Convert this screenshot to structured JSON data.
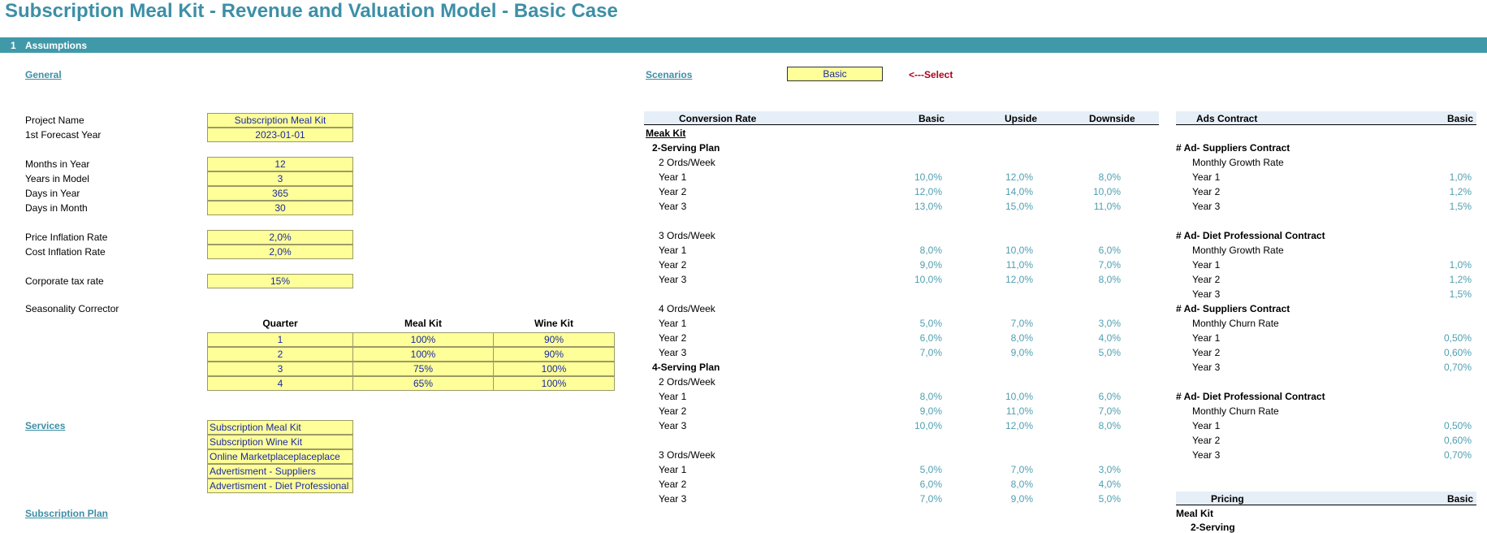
{
  "title": "Subscription Meal Kit - Revenue and Valuation Model - Basic Case",
  "section": {
    "number": "1",
    "label": "Assumptions"
  },
  "general": {
    "link": "General",
    "rows": [
      {
        "label": "Project Name",
        "value": "Subscription Meal Kit"
      },
      {
        "label": "1st Forecast Year",
        "value": "2023-01-01"
      },
      {
        "label": "Months in Year",
        "value": "12"
      },
      {
        "label": "Years in Model",
        "value": "3"
      },
      {
        "label": "Days in Year",
        "value": "365"
      },
      {
        "label": "Days in Month",
        "value": "30"
      },
      {
        "label": "Price Inflation Rate",
        "value": "2,0%"
      },
      {
        "label": "Cost Inflation Rate",
        "value": "2,0%"
      },
      {
        "label": "Corporate tax rate",
        "value": "15%"
      }
    ],
    "seasonality_label": "Seasonality Corrector",
    "seasonality_headers": [
      "Quarter",
      "Meal Kit",
      "Wine Kit"
    ],
    "seasonality_rows": [
      [
        "1",
        "100%",
        "90%"
      ],
      [
        "2",
        "100%",
        "90%"
      ],
      [
        "3",
        "75%",
        "100%"
      ],
      [
        "4",
        "65%",
        "100%"
      ]
    ]
  },
  "services": {
    "link": "Services",
    "items": [
      "Subscription Meal Kit",
      "Subscription Wine Kit",
      "Online Marketplaceplaceplace",
      "Advertisment - Suppliers",
      "Advertisment - Diet Professional"
    ]
  },
  "subscription_plan_link": "Subscription Plan",
  "scenarios": {
    "link": "Scenarios",
    "selected": "Basic",
    "hint": "<---Select"
  },
  "conversion": {
    "headers": [
      "Conversion Rate",
      "Basic",
      "Upside",
      "Downside"
    ],
    "group": "Meak Kit",
    "rows": [
      {
        "label": "2-Serving Plan",
        "kind": "plan"
      },
      {
        "label": "2 Ords/Week",
        "kind": "sub"
      },
      {
        "label": "Year 1",
        "kind": "year",
        "v": [
          "10,0%",
          "12,0%",
          "8,0%"
        ]
      },
      {
        "label": "Year 2",
        "kind": "year",
        "v": [
          "12,0%",
          "14,0%",
          "10,0%"
        ]
      },
      {
        "label": "Year 3",
        "kind": "year",
        "v": [
          "13,0%",
          "15,0%",
          "11,0%"
        ]
      },
      {
        "label": "",
        "kind": "blank"
      },
      {
        "label": "3 Ords/Week",
        "kind": "sub"
      },
      {
        "label": "Year 1",
        "kind": "year",
        "v": [
          "8,0%",
          "10,0%",
          "6,0%"
        ]
      },
      {
        "label": "Year 2",
        "kind": "year",
        "v": [
          "9,0%",
          "11,0%",
          "7,0%"
        ]
      },
      {
        "label": "Year 3",
        "kind": "year",
        "v": [
          "10,0%",
          "12,0%",
          "8,0%"
        ]
      },
      {
        "label": "",
        "kind": "blank"
      },
      {
        "label": "4 Ords/Week",
        "kind": "sub"
      },
      {
        "label": "Year 1",
        "kind": "year",
        "v": [
          "5,0%",
          "7,0%",
          "3,0%"
        ]
      },
      {
        "label": "Year 2",
        "kind": "year",
        "v": [
          "6,0%",
          "8,0%",
          "4,0%"
        ]
      },
      {
        "label": "Year 3",
        "kind": "year",
        "v": [
          "7,0%",
          "9,0%",
          "5,0%"
        ]
      },
      {
        "label": "4-Serving Plan",
        "kind": "plan"
      },
      {
        "label": "2 Ords/Week",
        "kind": "sub"
      },
      {
        "label": "Year 1",
        "kind": "year",
        "v": [
          "8,0%",
          "10,0%",
          "6,0%"
        ]
      },
      {
        "label": "Year 2",
        "kind": "year",
        "v": [
          "9,0%",
          "11,0%",
          "7,0%"
        ]
      },
      {
        "label": "Year 3",
        "kind": "year",
        "v": [
          "10,0%",
          "12,0%",
          "8,0%"
        ]
      },
      {
        "label": "",
        "kind": "blank"
      },
      {
        "label": "3 Ords/Week",
        "kind": "sub"
      },
      {
        "label": "Year 1",
        "kind": "year",
        "v": [
          "5,0%",
          "7,0%",
          "3,0%"
        ]
      },
      {
        "label": "Year 2",
        "kind": "year",
        "v": [
          "6,0%",
          "8,0%",
          "4,0%"
        ]
      },
      {
        "label": "Year 3",
        "kind": "year",
        "v": [
          "7,0%",
          "9,0%",
          "5,0%"
        ]
      }
    ]
  },
  "ads": {
    "headers": [
      "Ads Contract",
      "Basic"
    ],
    "rows": [
      {
        "label": "# Ad- Suppliers Contract",
        "kind": "group"
      },
      {
        "label": "Monthly Growth Rate",
        "kind": "sub"
      },
      {
        "label": "Year 1",
        "kind": "year",
        "v": "1,0%"
      },
      {
        "label": "Year 2",
        "kind": "year",
        "v": "1,2%"
      },
      {
        "label": "Year 3",
        "kind": "year",
        "v": "1,5%"
      },
      {
        "label": "",
        "kind": "blank"
      },
      {
        "label": "# Ad- Diet Professional Contract",
        "kind": "group"
      },
      {
        "label": "Monthly Growth Rate",
        "kind": "sub"
      },
      {
        "label": "Year 1",
        "kind": "year",
        "v": "1,0%"
      },
      {
        "label": "Year 2",
        "kind": "year",
        "v": "1,2%"
      },
      {
        "label": "Year 3",
        "kind": "year",
        "v": "1,5%"
      },
      {
        "label": "# Ad- Suppliers Contract",
        "kind": "group"
      },
      {
        "label": "Monthly Churn Rate",
        "kind": "sub"
      },
      {
        "label": "Year 1",
        "kind": "year",
        "v": "0,50%"
      },
      {
        "label": "Year 2",
        "kind": "year",
        "v": "0,60%"
      },
      {
        "label": "Year 3",
        "kind": "year",
        "v": "0,70%"
      },
      {
        "label": "",
        "kind": "blank"
      },
      {
        "label": "# Ad- Diet Professional Contract",
        "kind": "group"
      },
      {
        "label": "Monthly Churn Rate",
        "kind": "sub"
      },
      {
        "label": "Year 1",
        "kind": "year",
        "v": "0,50%"
      },
      {
        "label": "Year 2",
        "kind": "year",
        "v": "0,60%"
      },
      {
        "label": "Year 3",
        "kind": "year",
        "v": "0,70%"
      }
    ],
    "pricing_headers": [
      "Pricing",
      "Basic"
    ],
    "pricing_group": "Meal Kit",
    "pricing_sub": "2-Serving"
  }
}
